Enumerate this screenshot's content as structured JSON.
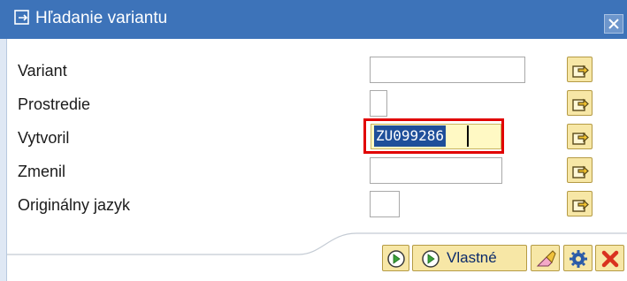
{
  "dialog": {
    "title": "Hľadanie variantu",
    "title_icon": "search-variant-icon",
    "close_icon": "close-icon"
  },
  "form": {
    "fields": [
      {
        "label": "Variant",
        "value": ""
      },
      {
        "label": "Prostredie",
        "value": ""
      },
      {
        "label": "Vytvoril",
        "value": "ZU099286"
      },
      {
        "label": "Zmenil",
        "value": ""
      },
      {
        "label": "Originálny jazyk",
        "value": ""
      }
    ],
    "select_icon": "multiple-selection-icon"
  },
  "footer": {
    "execute_icon": "execute-icon",
    "custom_label": "Vlastné",
    "custom_icon": "execute-icon",
    "clear_icon": "eraser-icon",
    "settings_icon": "settings-icon",
    "cancel_icon": "cancel-icon"
  },
  "colors": {
    "titlebar": "#3d73b9",
    "highlight_border": "#e10000",
    "button_fill": "#f7e7a6"
  }
}
